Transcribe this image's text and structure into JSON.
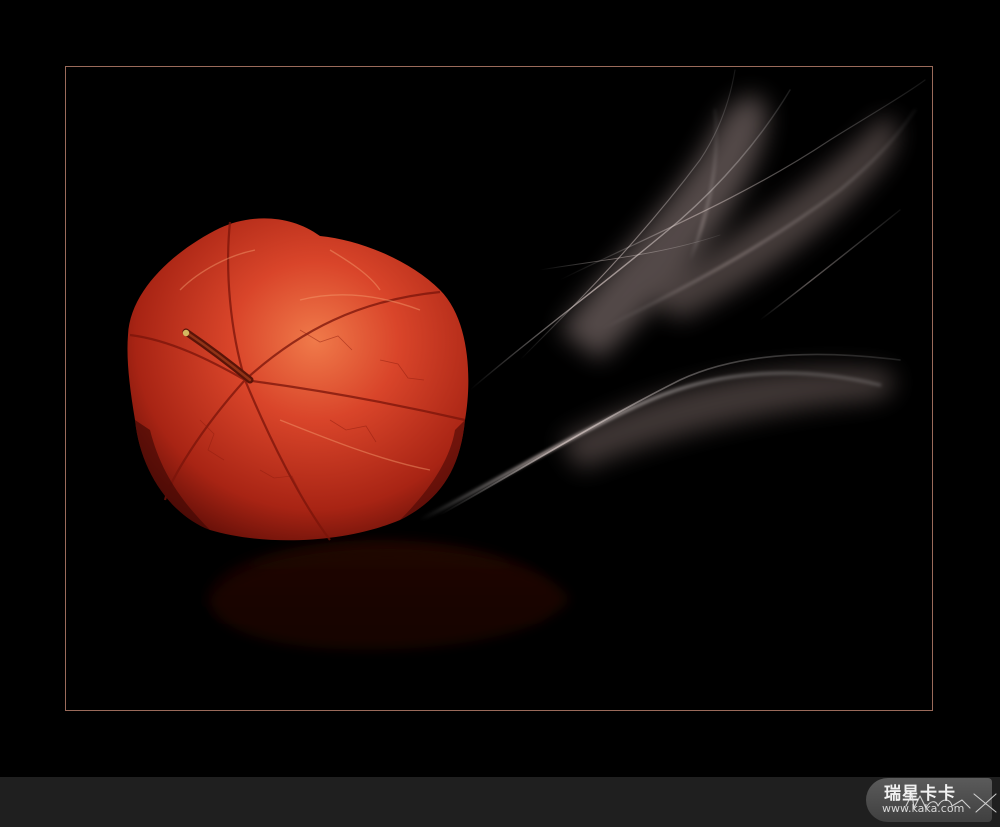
{
  "watermark": {
    "title": "瑞星卡卡",
    "url": "www.kaka.com"
  },
  "colors": {
    "background": "#000000",
    "frame_border": "#9a6a5a",
    "bottom_bar": "#1f1f1f",
    "lantern_red": "#c8331c",
    "smoke": "#d8c2be"
  },
  "icons": {
    "signature": "handwritten-signature-icon"
  }
}
